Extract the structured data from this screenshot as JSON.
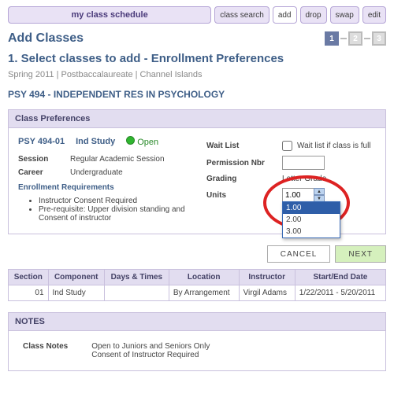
{
  "nav": {
    "schedule": "my class schedule",
    "search": "class search",
    "add": "add",
    "drop": "drop",
    "swap": "swap",
    "edit": "edit"
  },
  "header": {
    "title": "Add Classes",
    "step1": "1",
    "step2": "2",
    "step3": "3",
    "subtitle": "1.  Select classes to add - Enrollment Preferences",
    "meta": "Spring 2011 | Postbaccalaureate | Channel Islands",
    "course": "PSY  494 - INDEPENDENT RES IN PSYCHOLOGY"
  },
  "prefs": {
    "heading": "Class Preferences",
    "left": {
      "code": "PSY  494-01",
      "type": "Ind Study",
      "status": "Open",
      "session_k": "Session",
      "session_v": "Regular Academic Session",
      "career_k": "Career",
      "career_v": "Undergraduate",
      "enr_head": "Enrollment Requirements",
      "req1": "Instructor Consent Required",
      "req2": "Pre-requisite: Upper division standing and Consent of instructor"
    },
    "right": {
      "wait_k": "Wait List",
      "wait_v": "Wait list if class is full",
      "perm_k": "Permission Nbr",
      "perm_v": "",
      "grade_k": "Grading",
      "grade_v": "Letter Grade",
      "units_k": "Units",
      "units_sel": "1.00",
      "opts": [
        "1.00",
        "2.00",
        "3.00"
      ]
    }
  },
  "buttons": {
    "cancel": "CANCEL",
    "next": "NEXT"
  },
  "table": {
    "cols": [
      "Section",
      "Component",
      "Days & Times",
      "Location",
      "Instructor",
      "Start/End Date"
    ],
    "row": {
      "section": "01",
      "component": "Ind Study",
      "days": "",
      "location": "By Arrangement",
      "instructor": "Virgil Adams",
      "dates": "1/22/2011 - 5/20/2011"
    }
  },
  "notes": {
    "head": "NOTES",
    "k": "Class Notes",
    "line1": "Open to Juniors and Seniors Only",
    "line2": "Consent of Instructor Required"
  }
}
